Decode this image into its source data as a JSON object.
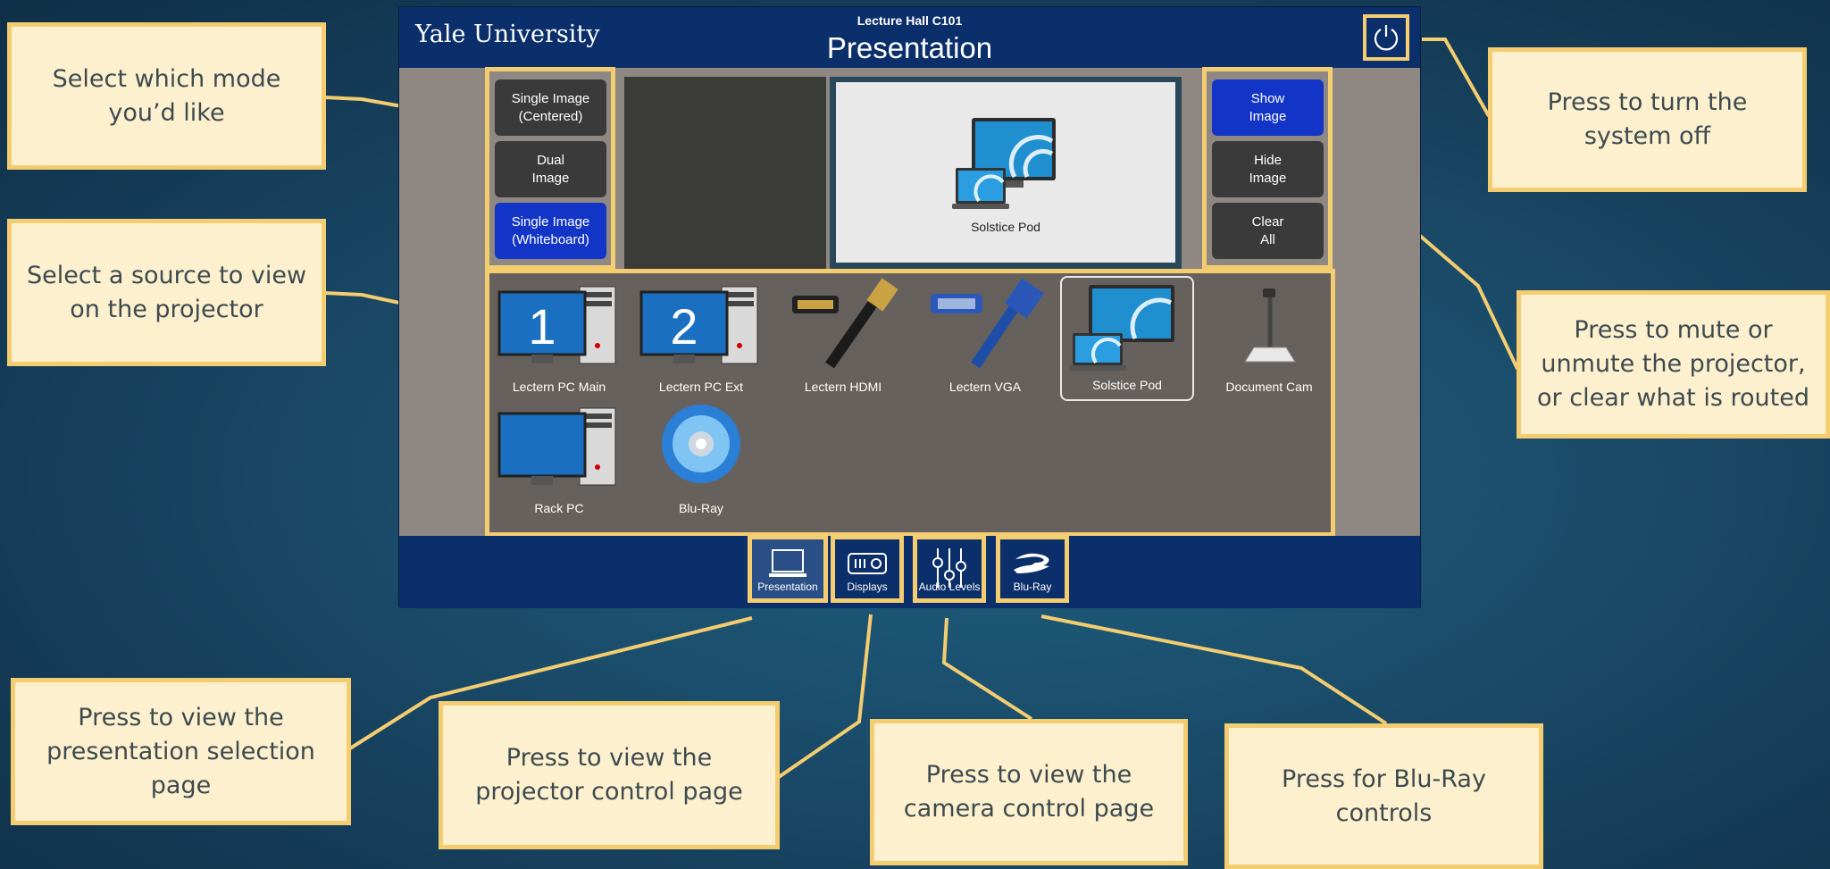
{
  "touchpanel": {
    "brand": "Yale University",
    "room": "Lecture Hall C101",
    "page_title": "Presentation",
    "modes": [
      {
        "label": "Single Image\n(Centered)",
        "active": false
      },
      {
        "label": "Dual\nImage",
        "active": false
      },
      {
        "label": "Single Image\n(Whiteboard)",
        "active": true
      }
    ],
    "display_controls": [
      {
        "label": "Show\nImage",
        "active": true
      },
      {
        "label": "Hide\nImage",
        "active": false
      },
      {
        "label": "Clear\nAll",
        "active": false
      }
    ],
    "preview": {
      "source_label": "Solstice Pod"
    },
    "sources": [
      {
        "label": "Lectern PC Main",
        "icon": "pc-1-icon",
        "selected": false
      },
      {
        "label": "Lectern PC Ext",
        "icon": "pc-2-icon",
        "selected": false
      },
      {
        "label": "Lectern HDMI",
        "icon": "hdmi-cable-icon",
        "selected": false
      },
      {
        "label": "Lectern VGA",
        "icon": "vga-cable-icon",
        "selected": false
      },
      {
        "label": "Solstice Pod",
        "icon": "wireless-display-icon",
        "selected": true
      },
      {
        "label": "Document Cam",
        "icon": "document-camera-icon",
        "selected": false
      },
      {
        "label": "Rack PC",
        "icon": "pc-icon",
        "selected": false
      },
      {
        "label": "Blu-Ray",
        "icon": "bluray-disc-icon",
        "selected": false
      }
    ],
    "nav": [
      {
        "label": "Presentation",
        "icon": "laptop-icon",
        "active": true
      },
      {
        "label": "Displays",
        "icon": "projector-icon",
        "active": false
      },
      {
        "label": "Audio Levels",
        "icon": "sliders-icon",
        "active": false
      },
      {
        "label": "Blu-Ray",
        "icon": "bluray-logo-icon",
        "active": false
      }
    ]
  },
  "callouts": {
    "mode": "Select which mode\nyou’d like",
    "source": "Select a source to view\non the projector",
    "power": "Press to turn the\nsystem off",
    "mute": "Press to mute or\nunmute the projector,\nor clear what is routed",
    "presentation": "Press to view the\npresentation selection\npage",
    "projector": "Press to view the\nprojector control page",
    "camera": "Press to view the\ncamera control page",
    "bluray": "Press for Blu-Ray\ncontrols"
  },
  "colors": {
    "callout_fill": "#fdf0cf",
    "callout_border": "#f4cd71",
    "panel_header": "#0b2f6b",
    "active_button": "#1235c8"
  }
}
